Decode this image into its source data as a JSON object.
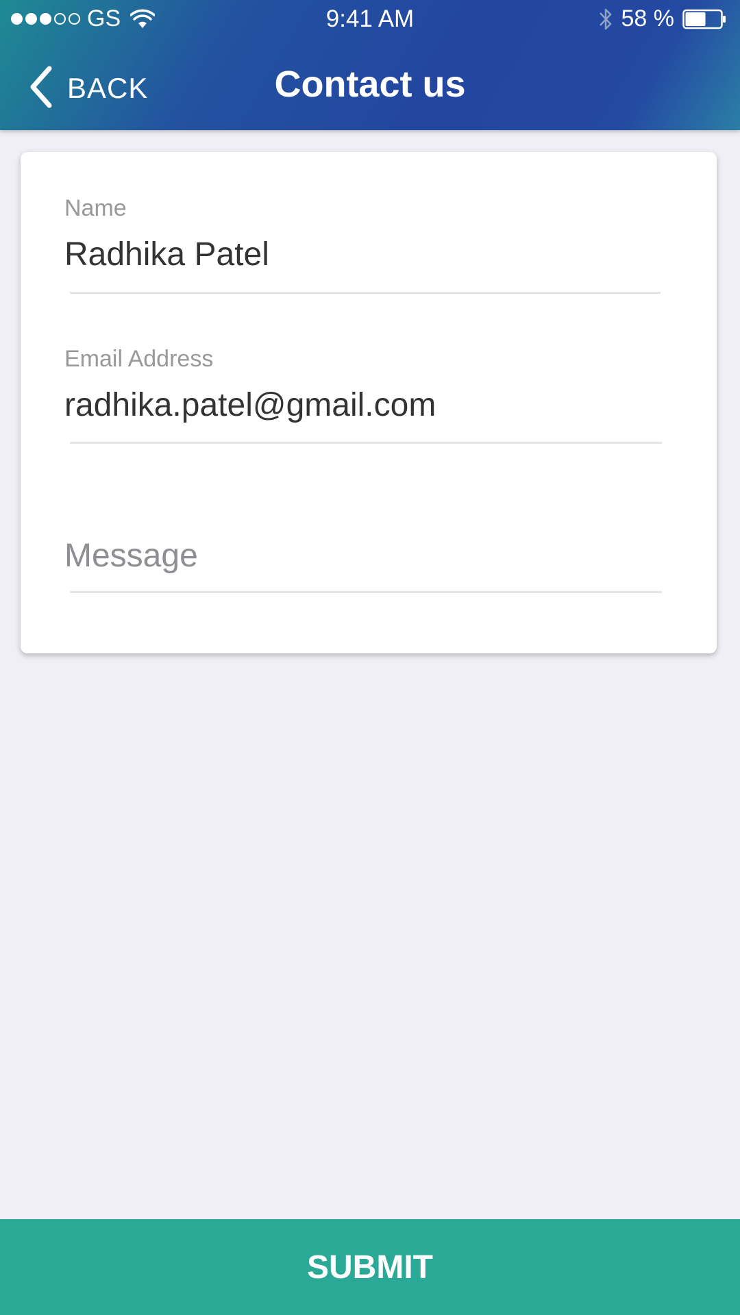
{
  "status_bar": {
    "carrier": "GS",
    "signal_filled": 3,
    "signal_total": 5,
    "time": "9:41 AM",
    "battery_percent_text": "58 %",
    "battery_level": 0.58,
    "icons": [
      "wifi-icon",
      "bluetooth-icon",
      "battery-icon"
    ]
  },
  "header": {
    "back_label": "BACK",
    "title": "Contact us",
    "icon": "chevron-left-icon"
  },
  "form": {
    "name": {
      "label": "Name",
      "value": "Radhika Patel"
    },
    "email": {
      "label": "Email Address",
      "value": "radhika.patel@gmail.com"
    },
    "message": {
      "placeholder": "Message"
    }
  },
  "submit_label": "SUBMIT",
  "colors": {
    "header_blue": "#2346a0",
    "header_teal": "#1f8a93",
    "submit_green": "#2aa996",
    "background": "#efeff5"
  }
}
